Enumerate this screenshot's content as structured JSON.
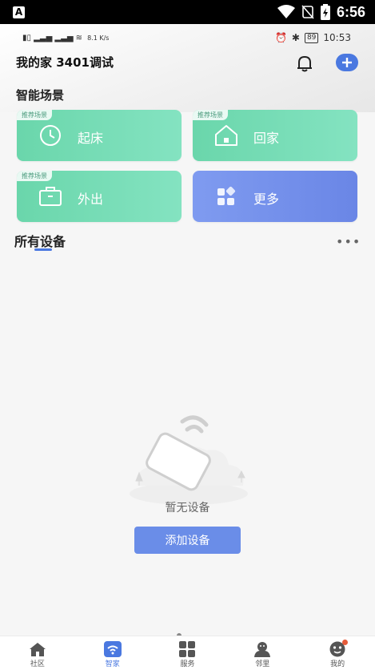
{
  "status_bar": {
    "time": "6:56",
    "app_icon_letter": "A"
  },
  "inner_status": {
    "time": "10:53",
    "battery": "89",
    "net_speed": "8.1 K/s"
  },
  "header": {
    "title": "我的家 3401调试"
  },
  "scenes": {
    "heading": "智能场景",
    "tag_label": "推荐场景",
    "items": [
      {
        "label": "起床",
        "icon": "clock-icon"
      },
      {
        "label": "回家",
        "icon": "home-icon"
      },
      {
        "label": "外出",
        "icon": "briefcase-icon"
      },
      {
        "label": "更多",
        "icon": "grid-icon"
      }
    ]
  },
  "devices": {
    "title": "所有设备",
    "empty_text": "暂无设备",
    "add_button": "添加设备"
  },
  "tabs": [
    {
      "label": "社区",
      "icon": "house-icon"
    },
    {
      "label": "智家",
      "icon": "wifi-icon",
      "active": true
    },
    {
      "label": "服务",
      "icon": "grid-icon"
    },
    {
      "label": "邻里",
      "icon": "people-icon"
    },
    {
      "label": "我的",
      "icon": "face-icon"
    }
  ],
  "colors": {
    "accent": "#4a78e0",
    "scene_green": "#72dbb4",
    "scene_blue": "#7592ec"
  }
}
